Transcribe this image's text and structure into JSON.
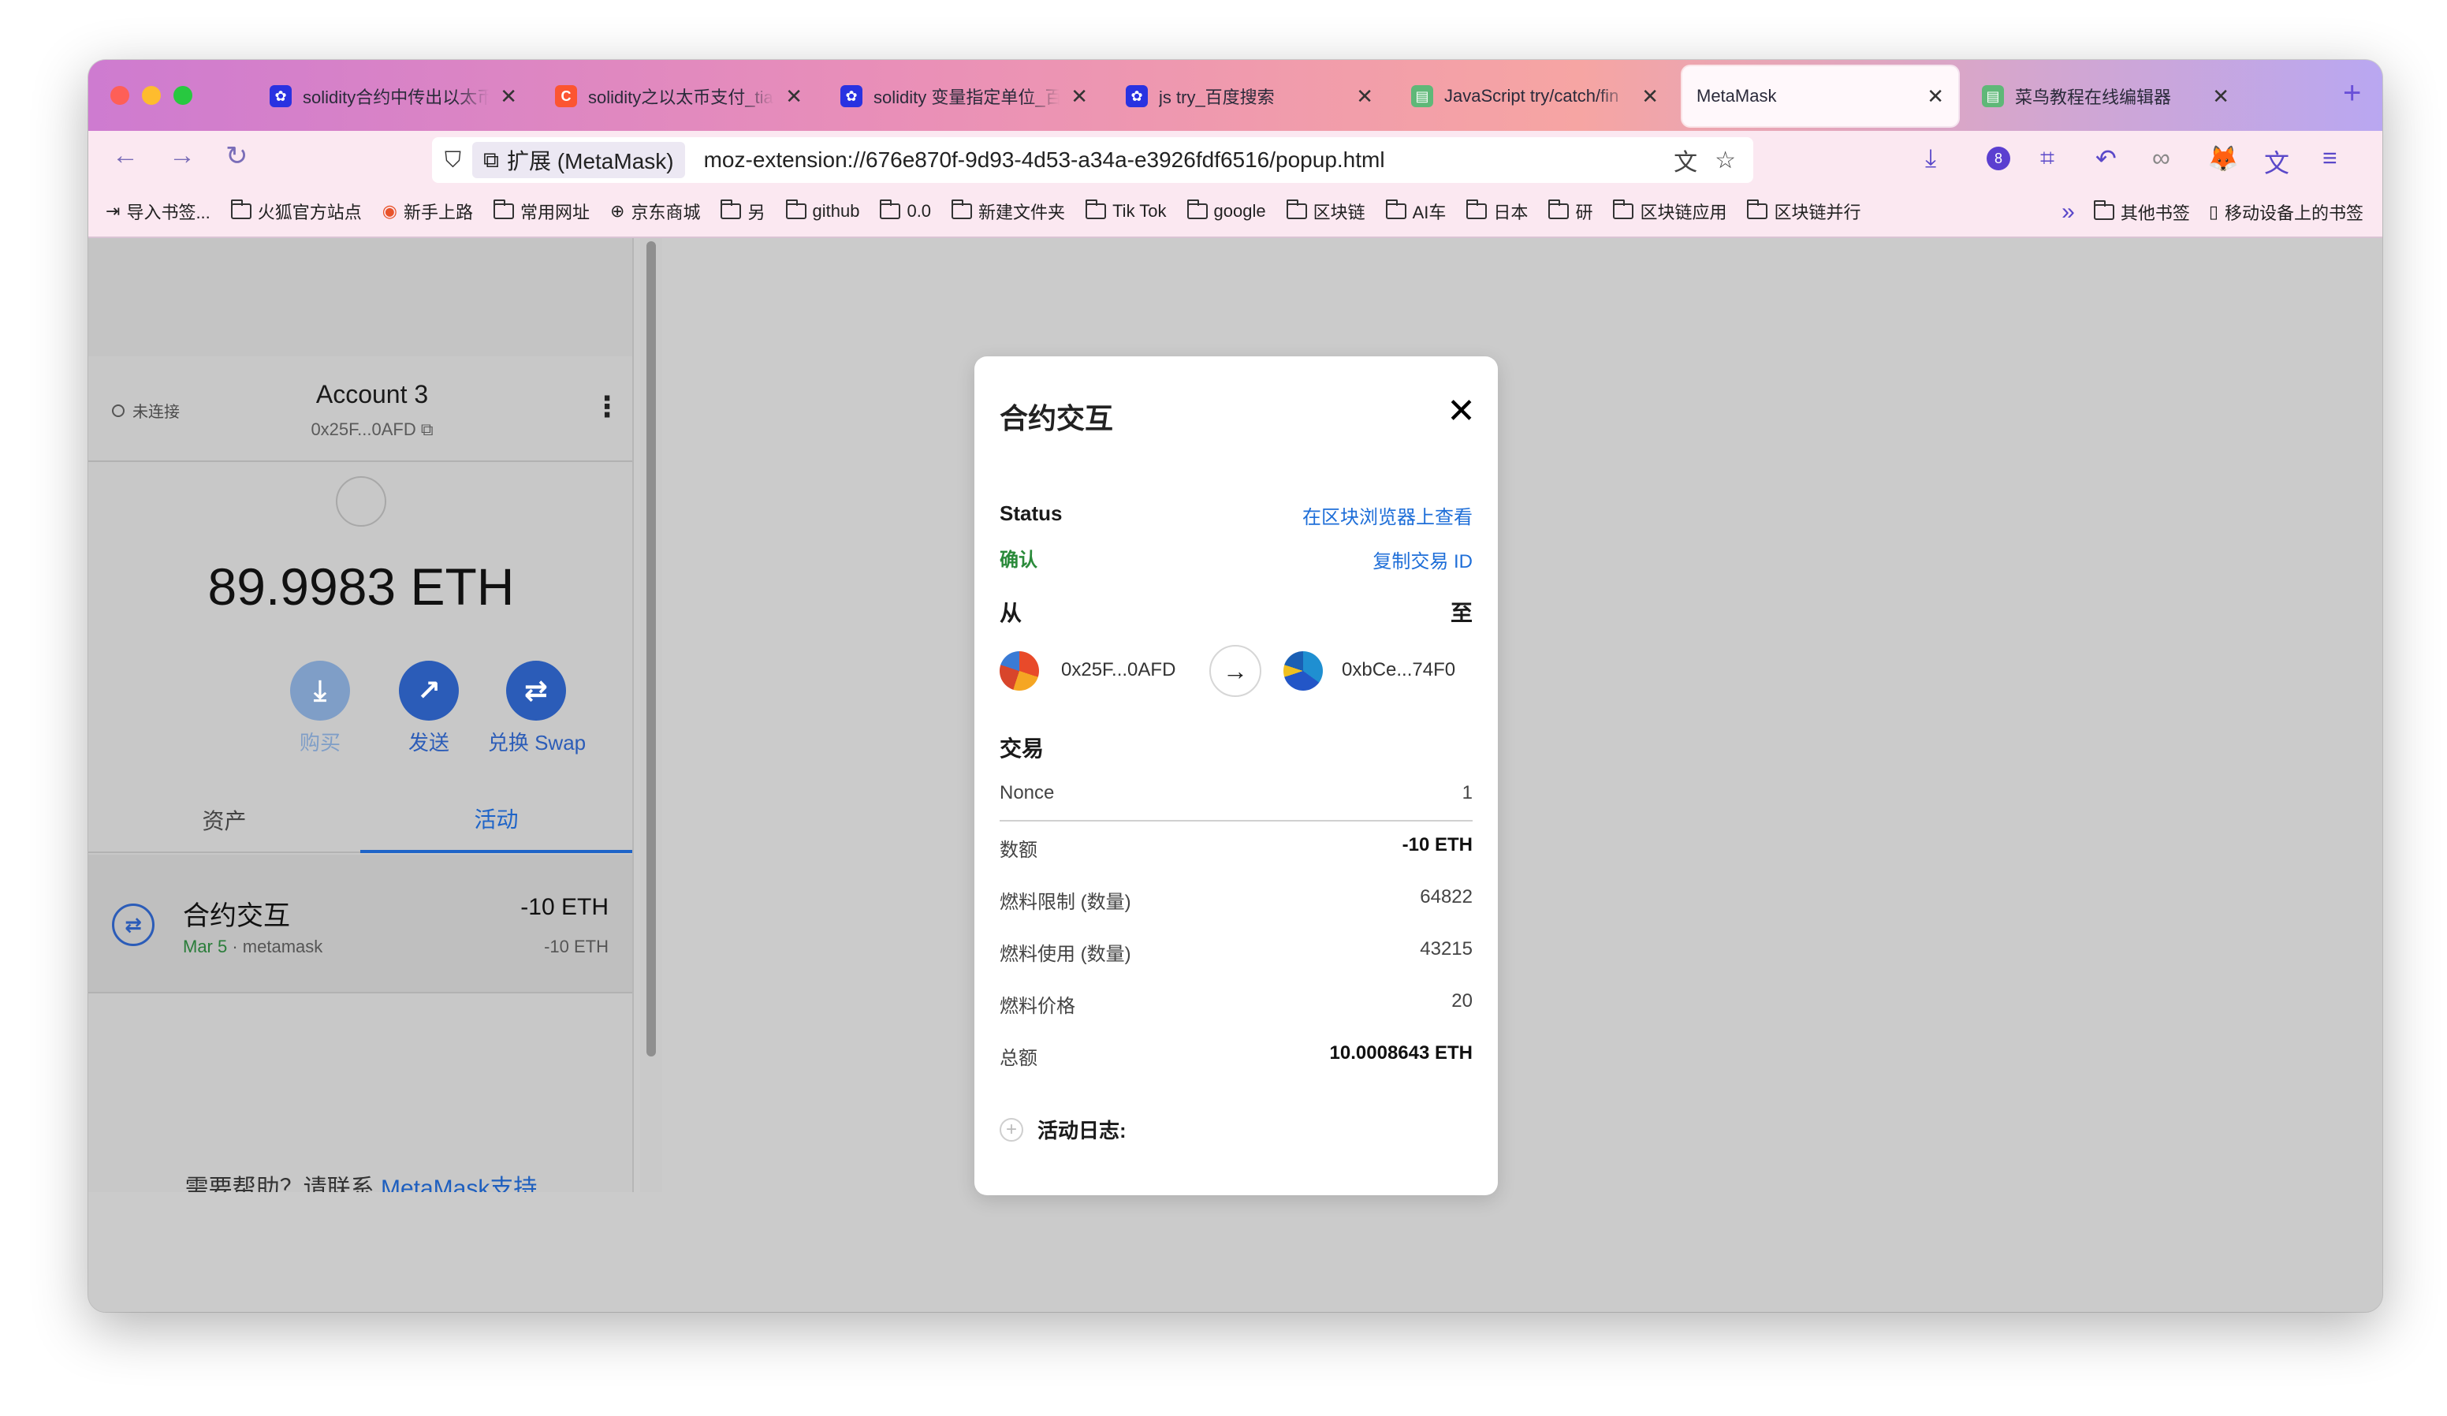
{
  "tabs": [
    {
      "title": "solidity合约中传出以太币",
      "favicon": "baidu"
    },
    {
      "title": "solidity之以太币支付_tia",
      "favicon": "csdn"
    },
    {
      "title": "solidity 变量指定单位_百",
      "favicon": "baidu"
    },
    {
      "title": "js try_百度搜索",
      "favicon": "baidu"
    },
    {
      "title": "JavaScript try/catch/fin",
      "favicon": "code"
    },
    {
      "title": "MetaMask",
      "favicon": "",
      "active": true
    },
    {
      "title": "菜鸟教程在线编辑器",
      "favicon": "code"
    }
  ],
  "urlbar": {
    "extension_label": "扩展 (MetaMask)",
    "url": "moz-extension://676e870f-9d93-4d53-a34a-e3926fdf6516/popup.html"
  },
  "toolbar": {
    "badge_count": "8"
  },
  "bookmarks": {
    "items": [
      "导入书签...",
      "火狐官方站点",
      "新手上路",
      "常用网址",
      "京东商城",
      "另",
      "github",
      "0.0",
      "新建文件夹",
      "Tik Tok",
      "google",
      "区块链",
      "AI车",
      "日本",
      "研",
      "区块链应用",
      "区块链并行"
    ],
    "other": "其他书签",
    "mobile": "移动设备上的书签"
  },
  "wallet": {
    "connection": "未连接",
    "account_name": "Account 3",
    "address": "0x25F...0AFD",
    "balance": "89.9983 ETH",
    "actions": {
      "buy": "购买",
      "send": "发送",
      "swap": "兑换 Swap"
    },
    "tabs": {
      "assets": "资产",
      "activity": "活动"
    },
    "tx": {
      "title": "合约交互",
      "date": "Mar 5",
      "origin": " · metamask",
      "amount": "-10 ETH",
      "amount_sub": "-10 ETH"
    },
    "help_prefix": "需要帮助？请联系 ",
    "help_link": "MetaMask支持"
  },
  "modal": {
    "title": "合约交互",
    "status_label": "Status",
    "view_on_explorer": "在区块浏览器上查看",
    "status_value": "确认",
    "copy_tx_id": "复制交易 ID",
    "from_label": "从",
    "to_label": "至",
    "from_address": "0x25F...0AFD",
    "to_address": "0xbCe...74F0",
    "tx_section": "交易",
    "rows": [
      {
        "label": "Nonce",
        "value": "1"
      },
      {
        "label": "数额",
        "value": "-10 ETH"
      },
      {
        "label": "燃料限制 (数量)",
        "value": "64822"
      },
      {
        "label": "燃料使用 (数量)",
        "value": "43215"
      },
      {
        "label": "燃料价格",
        "value": "20"
      },
      {
        "label": "总额",
        "value": "10.0008643 ETH"
      }
    ],
    "activity_log": "活动日志:"
  },
  "colors": {
    "accent_blue": "#1e6ed8",
    "confirmed_green": "#2a8a3a",
    "toolbar_purple": "#5a48c9"
  }
}
